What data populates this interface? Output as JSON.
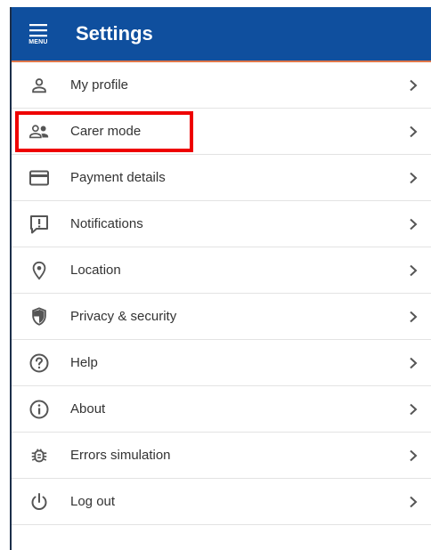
{
  "header": {
    "menu_label": "MENU",
    "title": "Settings",
    "bg_color": "#0f4f9e",
    "accent_border": "#e0784a"
  },
  "items": [
    {
      "label": "My profile",
      "icon": "person-icon"
    },
    {
      "label": "Carer mode",
      "icon": "people-icon",
      "highlighted": true
    },
    {
      "label": "Payment details",
      "icon": "credit-card-icon"
    },
    {
      "label": "Notifications",
      "icon": "notification-alert-icon"
    },
    {
      "label": "Location",
      "icon": "location-pin-icon"
    },
    {
      "label": "Privacy & security",
      "icon": "shield-icon"
    },
    {
      "label": "Help",
      "icon": "help-circle-icon"
    },
    {
      "label": "About",
      "icon": "info-circle-icon"
    },
    {
      "label": "Errors simulation",
      "icon": "bug-icon"
    },
    {
      "label": "Log out",
      "icon": "power-icon"
    }
  ],
  "highlight_color": "#ee0000"
}
